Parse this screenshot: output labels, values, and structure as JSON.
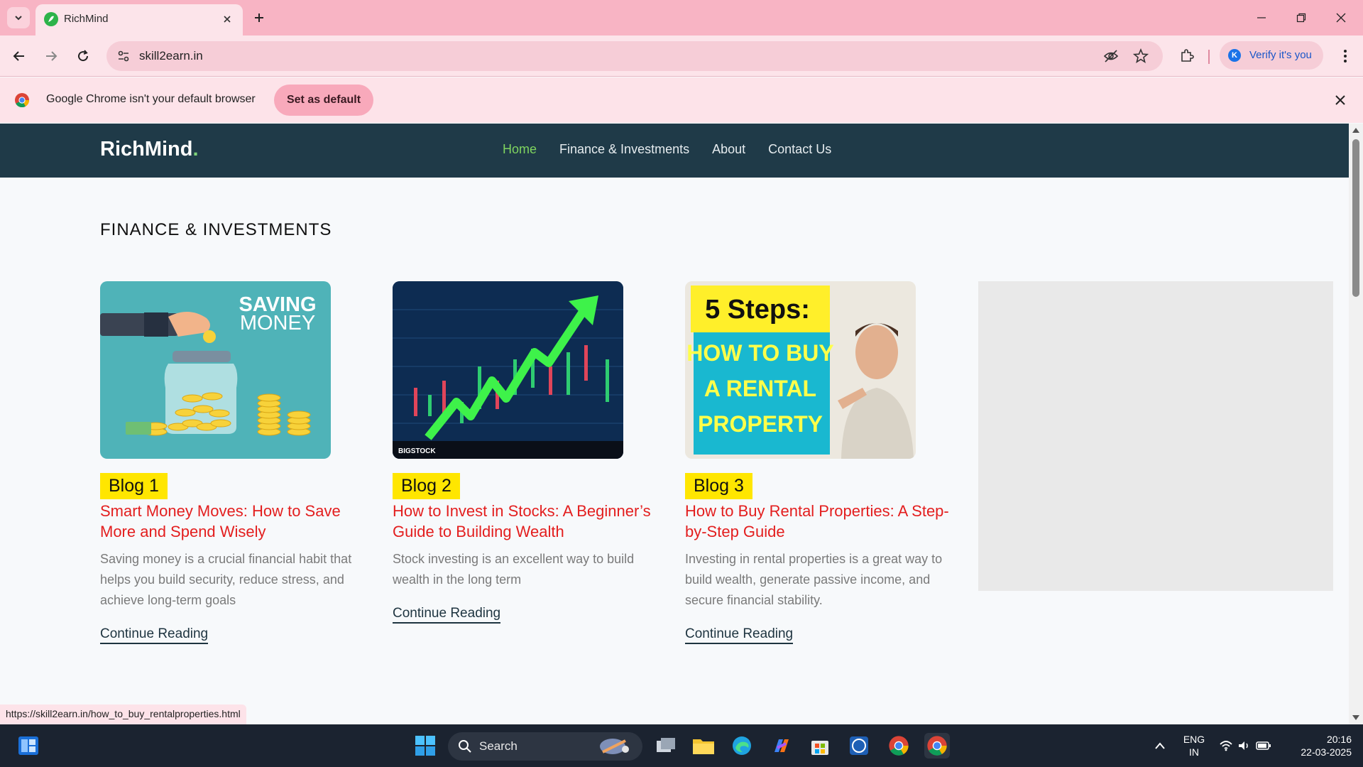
{
  "browser": {
    "tab_title": "RichMind",
    "url": "skill2earn.in",
    "profile_label": "Verify it's you",
    "profile_initial": "K",
    "infobar_text": "Google Chrome isn't your default browser",
    "set_default_label": "Set as default",
    "status_url": "https://skill2earn.in/how_to_buy_rentalproperties.html"
  },
  "site": {
    "brand": "RichMind",
    "brand_dot": ".",
    "nav": [
      "Home",
      "Finance & Investments",
      "About",
      "Contact Us"
    ],
    "active_nav": "Home",
    "section_title": "FINANCE & INVESTMENTS"
  },
  "cards": [
    {
      "badge": "Blog 1",
      "title": "Smart Money Moves: How to Save More and Spend Wisely",
      "excerpt": "Saving money is a crucial financial habit that helps you build security, reduce stress, and achieve long-term goals",
      "link": "Continue Reading",
      "image_text_1": "SAVING",
      "image_text_2": "MONEY"
    },
    {
      "badge": "Blog 2",
      "title": "How to Invest in Stocks: A Beginner’s Guide to Building Wealth",
      "excerpt": "Stock investing is an excellent way to build wealth in the long term",
      "link": "Continue Reading",
      "image_text_1": "BIGSTOCK"
    },
    {
      "badge": "Blog 3",
      "title": "How to Buy Rental Properties: A Step-by-Step Guide",
      "excerpt": "Investing in rental properties is a great way to build wealth, generate passive income, and secure financial stability.",
      "link": "Continue Reading",
      "image_text_1": "5 Steps:",
      "image_text_2": "HOW TO BUY",
      "image_text_3": "A RENTAL",
      "image_text_4": "PROPERTY"
    }
  ],
  "taskbar": {
    "search_label": "Search",
    "lang_line1": "ENG",
    "lang_line2": "IN",
    "time": "20:16",
    "date": "22-03-2025"
  },
  "colors": {
    "accent_nav": "#7fd45f",
    "title_red": "#e31e1e",
    "badge_yellow": "#ffe600",
    "header_bg": "#1f3a48"
  }
}
